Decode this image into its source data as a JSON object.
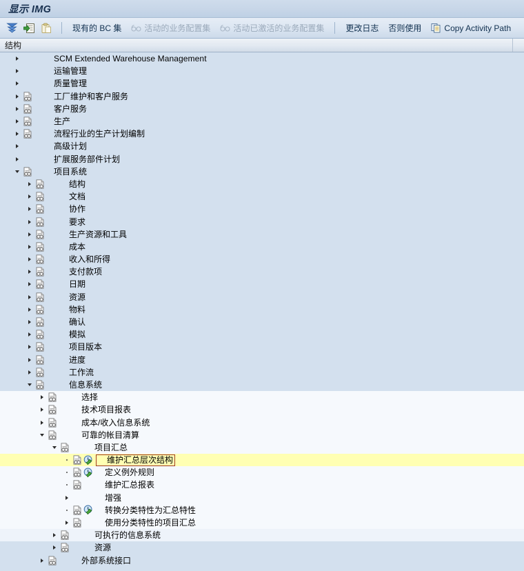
{
  "window": {
    "title": "显示 IMG"
  },
  "toolbar": {
    "icon_buttons": [
      {
        "name": "collapse-all-icon",
        "title": ""
      },
      {
        "name": "expand-node-icon",
        "title": ""
      },
      {
        "name": "paste-clipboard-icon",
        "title": ""
      }
    ],
    "buttons": [
      {
        "label": "现有的 BC 集",
        "icon": "",
        "disabled": false
      },
      {
        "label": "活动的业务配置集",
        "icon": "glasses-icon",
        "disabled": true
      },
      {
        "label": "活动已激活的业务配置集",
        "icon": "glasses-icon",
        "disabled": true
      },
      {
        "label": "更改日志",
        "icon": "",
        "disabled": false
      },
      {
        "label": "否则使用",
        "icon": "",
        "disabled": false
      },
      {
        "label": "Copy Activity Path",
        "icon": "copy-icon",
        "disabled": false
      }
    ]
  },
  "column_header": {
    "structure": "结构"
  },
  "colors": {
    "row_blue": "#d3e0ee",
    "row_light": "#eef3fa",
    "row_lighter": "#f6f9fd",
    "selection_yellow": "#ffffb3",
    "selection_border": "#a03c20",
    "title_text": "#18304f"
  },
  "tree": {
    "rows": [
      {
        "label": "SCM Extended Warehouse Management",
        "depth": 1,
        "twisty": "collapsed",
        "doc": false,
        "action": "none",
        "selected": false,
        "latin": true
      },
      {
        "label": "运输管理",
        "depth": 1,
        "twisty": "collapsed",
        "doc": false,
        "action": "none",
        "selected": false,
        "latin": false
      },
      {
        "label": "质量管理",
        "depth": 1,
        "twisty": "collapsed",
        "doc": false,
        "action": "none",
        "selected": false,
        "latin": false
      },
      {
        "label": "工厂维护和客户服务",
        "depth": 1,
        "twisty": "collapsed",
        "doc": true,
        "action": "none",
        "selected": false,
        "latin": false
      },
      {
        "label": "客户服务",
        "depth": 1,
        "twisty": "collapsed",
        "doc": true,
        "action": "none",
        "selected": false,
        "latin": false
      },
      {
        "label": "生产",
        "depth": 1,
        "twisty": "collapsed",
        "doc": true,
        "action": "none",
        "selected": false,
        "latin": false
      },
      {
        "label": "流程行业的生产计划编制",
        "depth": 1,
        "twisty": "collapsed",
        "doc": true,
        "action": "none",
        "selected": false,
        "latin": false
      },
      {
        "label": "高级计划",
        "depth": 1,
        "twisty": "collapsed",
        "doc": false,
        "action": "none",
        "selected": false,
        "latin": false
      },
      {
        "label": "扩展服务部件计划",
        "depth": 1,
        "twisty": "collapsed",
        "doc": false,
        "action": "none",
        "selected": false,
        "latin": false
      },
      {
        "label": "项目系统",
        "depth": 1,
        "twisty": "expanded",
        "doc": true,
        "action": "none",
        "selected": false,
        "latin": false
      },
      {
        "label": "结构",
        "depth": 2,
        "twisty": "collapsed",
        "doc": true,
        "action": "none",
        "selected": false,
        "latin": false
      },
      {
        "label": "文档",
        "depth": 2,
        "twisty": "collapsed",
        "doc": true,
        "action": "none",
        "selected": false,
        "latin": false
      },
      {
        "label": "协作",
        "depth": 2,
        "twisty": "collapsed",
        "doc": true,
        "action": "none",
        "selected": false,
        "latin": false
      },
      {
        "label": "要求",
        "depth": 2,
        "twisty": "collapsed",
        "doc": true,
        "action": "none",
        "selected": false,
        "latin": false
      },
      {
        "label": "生产资源和工具",
        "depth": 2,
        "twisty": "collapsed",
        "doc": true,
        "action": "none",
        "selected": false,
        "latin": false
      },
      {
        "label": "成本",
        "depth": 2,
        "twisty": "collapsed",
        "doc": true,
        "action": "none",
        "selected": false,
        "latin": false
      },
      {
        "label": "收入和所得",
        "depth": 2,
        "twisty": "collapsed",
        "doc": true,
        "action": "none",
        "selected": false,
        "latin": false
      },
      {
        "label": "支付款项",
        "depth": 2,
        "twisty": "collapsed",
        "doc": true,
        "action": "none",
        "selected": false,
        "latin": false
      },
      {
        "label": "日期",
        "depth": 2,
        "twisty": "collapsed",
        "doc": true,
        "action": "none",
        "selected": false,
        "latin": false
      },
      {
        "label": "资源",
        "depth": 2,
        "twisty": "collapsed",
        "doc": true,
        "action": "none",
        "selected": false,
        "latin": false
      },
      {
        "label": "物料",
        "depth": 2,
        "twisty": "collapsed",
        "doc": true,
        "action": "none",
        "selected": false,
        "latin": false
      },
      {
        "label": "确认",
        "depth": 2,
        "twisty": "collapsed",
        "doc": true,
        "action": "none",
        "selected": false,
        "latin": false
      },
      {
        "label": "模拟",
        "depth": 2,
        "twisty": "collapsed",
        "doc": true,
        "action": "none",
        "selected": false,
        "latin": false
      },
      {
        "label": "项目版本",
        "depth": 2,
        "twisty": "collapsed",
        "doc": true,
        "action": "none",
        "selected": false,
        "latin": false
      },
      {
        "label": "进度",
        "depth": 2,
        "twisty": "collapsed",
        "doc": true,
        "action": "none",
        "selected": false,
        "latin": false
      },
      {
        "label": "工作流",
        "depth": 2,
        "twisty": "collapsed",
        "doc": true,
        "action": "none",
        "selected": false,
        "latin": false
      },
      {
        "label": "信息系统",
        "depth": 2,
        "twisty": "expanded",
        "doc": true,
        "action": "none",
        "selected": false,
        "latin": false
      },
      {
        "label": "选择",
        "depth": 3,
        "twisty": "collapsed",
        "doc": true,
        "action": "none",
        "selected": false,
        "latin": false
      },
      {
        "label": "技术项目报表",
        "depth": 3,
        "twisty": "collapsed",
        "doc": true,
        "action": "none",
        "selected": false,
        "latin": false
      },
      {
        "label": "成本/收入信息系统",
        "depth": 3,
        "twisty": "collapsed",
        "doc": true,
        "action": "none",
        "selected": false,
        "latin": false
      },
      {
        "label": "可靠的帐目清算",
        "depth": 3,
        "twisty": "expanded",
        "doc": true,
        "action": "none",
        "selected": false,
        "latin": false
      },
      {
        "label": "项目汇总",
        "depth": 4,
        "twisty": "expanded",
        "doc": true,
        "action": "none",
        "selected": false,
        "latin": false
      },
      {
        "label": "维护汇总层次结构",
        "depth": 5,
        "twisty": "leaf",
        "doc": true,
        "action": "executable",
        "selected": true,
        "latin": false
      },
      {
        "label": "定义例外规则",
        "depth": 5,
        "twisty": "leaf",
        "doc": true,
        "action": "executable",
        "selected": false,
        "latin": false
      },
      {
        "label": "维护汇总报表",
        "depth": 5,
        "twisty": "leaf",
        "doc": true,
        "action": "none",
        "selected": false,
        "latin": false
      },
      {
        "label": "增强",
        "depth": 5,
        "twisty": "collapsed",
        "doc": false,
        "action": "none",
        "selected": false,
        "latin": false
      },
      {
        "label": "转换分类特性为汇总特性",
        "depth": 5,
        "twisty": "leaf",
        "doc": true,
        "action": "executable",
        "selected": false,
        "latin": false
      },
      {
        "label": "使用分类特性的项目汇总",
        "depth": 5,
        "twisty": "collapsed",
        "doc": true,
        "action": "none",
        "selected": false,
        "latin": false
      },
      {
        "label": "可执行的信息系统",
        "depth": 4,
        "twisty": "collapsed",
        "doc": true,
        "action": "none",
        "selected": false,
        "latin": false
      },
      {
        "label": "资源",
        "depth": 4,
        "twisty": "collapsed",
        "doc": true,
        "action": "none",
        "selected": false,
        "latin": false
      },
      {
        "label": "外部系统接口",
        "depth": 3,
        "twisty": "collapsed",
        "doc": true,
        "action": "none",
        "selected": false,
        "latin": false
      }
    ]
  }
}
